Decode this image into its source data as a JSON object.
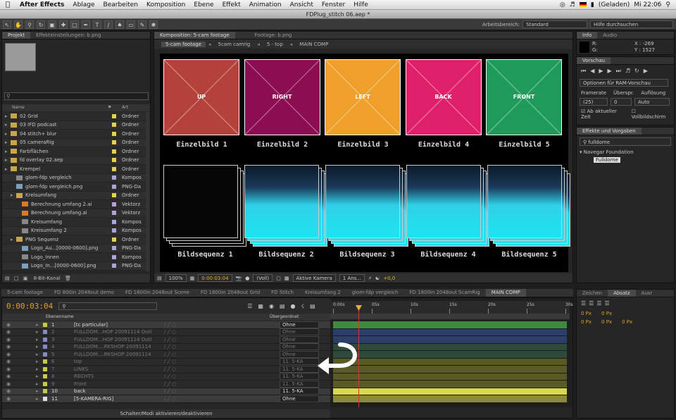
{
  "menubar": {
    "app": "After Effects",
    "items": [
      "Ablage",
      "Bearbeiten",
      "Komposition",
      "Ebene",
      "Effekt",
      "Animation",
      "Ansicht",
      "Fenster",
      "Hilfe"
    ],
    "battery": "(Geladen)",
    "clock": "Mi 22:06"
  },
  "window_title": "FDPlug_stitch 06.aep *",
  "toolbar": {
    "workspace_label": "Arbeitsbereich:",
    "workspace_value": "Standard",
    "help_placeholder": "Hilfe durchsuchen"
  },
  "project": {
    "tabs": [
      "Projekt",
      "Effekteinstellungen: b.png"
    ],
    "col_name": "Name",
    "col_type": "Art",
    "items": [
      {
        "name": "02 Grid",
        "type": "Ordner",
        "kind": "folder",
        "indent": 0,
        "color": "#e6d24a"
      },
      {
        "name": "03 IFD podcast",
        "type": "Ordner",
        "kind": "folder",
        "indent": 0,
        "color": "#e6d24a"
      },
      {
        "name": "04 stitch+ blur",
        "type": "Ordner",
        "kind": "folder",
        "indent": 0,
        "color": "#e6d24a"
      },
      {
        "name": "05 cameraRig",
        "type": "Ordner",
        "kind": "folder",
        "indent": 0,
        "color": "#e6d24a"
      },
      {
        "name": "Farbflächen",
        "type": "Ordner",
        "kind": "folder",
        "indent": 0,
        "color": "#e6d24a"
      },
      {
        "name": "fd overlay 02.aep",
        "type": "Ordner",
        "kind": "folder",
        "indent": 0,
        "color": "#e6d24a"
      },
      {
        "name": "Krempel",
        "type": "Ordner",
        "kind": "folder",
        "indent": 0,
        "color": "#e6d24a"
      },
      {
        "name": "glom-fdp vergleich",
        "type": "Kompos",
        "kind": "comp",
        "indent": 1,
        "color": "#a8a8d8"
      },
      {
        "name": "glom-fdp vergleich.png",
        "type": "PNG-Da",
        "kind": "png",
        "indent": 1,
        "color": "#a8a8d8"
      },
      {
        "name": "Kreisumfang",
        "type": "Ordner",
        "kind": "folder",
        "indent": 1,
        "color": "#e6d24a"
      },
      {
        "name": "Berechnung umfang 2.ai",
        "type": "Vektorz",
        "kind": "ai",
        "indent": 2,
        "color": "#b8a0d8"
      },
      {
        "name": "Berechnung umfang.ai",
        "type": "Vektorz",
        "kind": "ai",
        "indent": 2,
        "color": "#b8a0d8"
      },
      {
        "name": "Kreisumfang",
        "type": "Kompos",
        "kind": "comp",
        "indent": 2,
        "color": "#a8a8d8"
      },
      {
        "name": "Kreisumfang 2",
        "type": "Kompos",
        "kind": "comp",
        "indent": 2,
        "color": "#a8a8d8"
      },
      {
        "name": "PNG Sequenz",
        "type": "Ordner",
        "kind": "folder",
        "indent": 1,
        "color": "#e6d24a"
      },
      {
        "name": "Logo_Au...[0000-0600].png",
        "type": "PNG-Da",
        "kind": "png",
        "indent": 2,
        "color": "#a8a8d8"
      },
      {
        "name": "Logo_Innen",
        "type": "Kompos",
        "kind": "comp",
        "indent": 2,
        "color": "#a8a8d8"
      },
      {
        "name": "Logo_In...[0000-0600].png",
        "type": "PNG-Da",
        "kind": "png",
        "indent": 2,
        "color": "#a8a8d8"
      }
    ],
    "bpc": "8-Bit-Kanal"
  },
  "comp": {
    "tab": "Komposition: 5-cam footage",
    "footage_tab": "Footage: b.png",
    "breadcrumb": [
      "5-cam footage",
      "5cam camrig",
      "5 - top",
      "MAIN COMP"
    ],
    "faces": [
      {
        "label": "UP",
        "color": "#b5413b",
        "caption": "Einzelbild 1"
      },
      {
        "label": "RIGHT",
        "color": "#8c0d52",
        "caption": "Einzelbild 2"
      },
      {
        "label": "LEFT",
        "color": "#f0a02a",
        "caption": "Einzelbild 3"
      },
      {
        "label": "BACK",
        "color": "#e0206a",
        "caption": "Einzelbild 4"
      },
      {
        "label": "FRONT",
        "color": "#1e9a5a",
        "caption": "Einzelbild 5"
      }
    ],
    "sequences": [
      "Bildsequenz 1",
      "Bildsequenz 2",
      "Bildsequenz 3",
      "Bildsequenz 4",
      "Bildsequenz 5"
    ],
    "footer": {
      "zoom": "100%",
      "time": "0:00:03:04",
      "resolution": "(Voll)",
      "camera": "Aktive Kamera",
      "views": "1 Ans...",
      "exposure": "+0,0"
    }
  },
  "info": {
    "tabs": [
      "Info",
      "Audio"
    ],
    "r": "R:",
    "g": "G:",
    "x": "X : -269",
    "y": "Y : 1527"
  },
  "preview": {
    "tab": "Vorschau",
    "ram": "Optionen für RAM-Vorschau",
    "framerate_label": "Framerate",
    "skip_label": "Überspr.",
    "res_label": "Auflösung",
    "framerate": "(25)",
    "skip": "0",
    "res": "Auto",
    "ab_current": "Ab aktueller Zeit",
    "fullscreen": "Vollbildschirm"
  },
  "effects": {
    "tab": "Effekte und Vorgaben",
    "search": "fulldome",
    "group": "Navegar Foundation",
    "item": "Fulldome"
  },
  "char": {
    "tabs": [
      "Zeichen",
      "Absatz",
      "Ausr"
    ],
    "v1": "0 Px",
    "v2": "0 Px",
    "v3": "0 Px",
    "v4": "0 Px",
    "v5": "0 Px"
  },
  "timeline": {
    "tabs": [
      "5-cam footage",
      "FD 800in 2048out demo",
      "FD 1800in 2048out Scene",
      "FD 1800in 2048out Grid",
      "FD Stitch",
      "Kreisumfang 2",
      "glom-fdp vergleich",
      "FD 1800in 2048out ScamRig",
      "MAIN COMP"
    ],
    "time": "0:00:03:04",
    "col_layer": "Ebenenname",
    "col_parent": "Übergeordnet",
    "ruler": [
      "0:00s",
      "05s",
      "10s",
      "15s",
      "20s",
      "25s",
      "30s"
    ],
    "layers": [
      {
        "n": "1",
        "name": "[tc particular]",
        "parent": "Ohne",
        "color": "#c8c84a",
        "sel": true,
        "bar": "#3e8a3e"
      },
      {
        "n": "2",
        "name": "FULLDOM...HOP 20091114 Outl",
        "parent": "Ohne",
        "color": "#8888c8",
        "sel": false,
        "bar": "#2e3e6a"
      },
      {
        "n": "3",
        "name": "FULLDOM...HOP 20091114 Outl",
        "parent": "Ohne",
        "color": "#8888c8",
        "sel": false,
        "bar": "#2e3e6a"
      },
      {
        "n": "4",
        "name": "FULLDOM....RKSHOP 20091114",
        "parent": "Ohne",
        "color": "#8888c8",
        "sel": false,
        "bar": "#2e4a3a"
      },
      {
        "n": "5",
        "name": "FULLDOM....RKSHOP 20091114",
        "parent": "Ohne",
        "color": "#8888c8",
        "sel": false,
        "bar": "#2e4a3a"
      },
      {
        "n": "6",
        "name": "top",
        "parent": "11. 5-KA",
        "color": "#c8c84a",
        "sel": false,
        "bar": "#5a5a28"
      },
      {
        "n": "7",
        "name": "LINKS",
        "parent": "11. 5-KA",
        "color": "#c8c84a",
        "sel": false,
        "bar": "#5a5a28"
      },
      {
        "n": "8",
        "name": "RECHTS",
        "parent": "11. 5-KA",
        "color": "#c8c84a",
        "sel": false,
        "bar": "#5a5a28"
      },
      {
        "n": "9",
        "name": "Front",
        "parent": "11. 5-KA",
        "color": "#c8c84a",
        "sel": false,
        "bar": "#5a5a28"
      },
      {
        "n": "10",
        "name": "back",
        "parent": "11. 5-KA",
        "color": "#c8c84a",
        "sel": true,
        "bar": "#d8d84a"
      },
      {
        "n": "11",
        "name": "[5-KAMERA-RIG]",
        "parent": "Ohne",
        "color": "#e0e0e0",
        "sel": true,
        "bar": "#8a8a3a"
      }
    ],
    "switch_label": "Schalter/Modi aktivieren/deaktivieren"
  }
}
